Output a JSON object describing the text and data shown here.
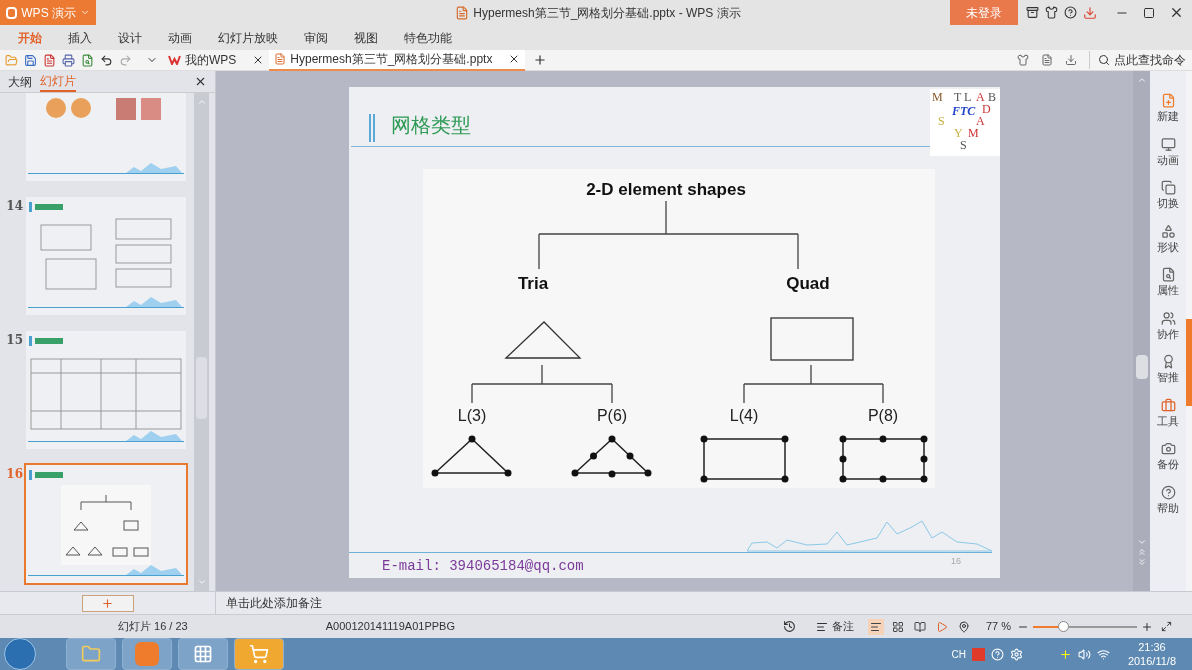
{
  "app_button": {
    "label": "WPS 演示"
  },
  "window": {
    "title": "Hypermesh第三节_网格划分基础.pptx - WPS 演示"
  },
  "login_button": {
    "label": "未登录"
  },
  "menu": [
    {
      "label": "开始",
      "selected": true
    },
    {
      "label": "插入",
      "selected": false
    },
    {
      "label": "设计",
      "selected": false
    },
    {
      "label": "动画",
      "selected": false
    },
    {
      "label": "幻灯片放映",
      "selected": false
    },
    {
      "label": "审阅",
      "selected": false
    },
    {
      "label": "视图",
      "selected": false
    },
    {
      "label": "特色功能",
      "selected": false
    }
  ],
  "doc_tabs": [
    {
      "label": "我的WPS",
      "kind": "home",
      "selected": false
    },
    {
      "label": "Hypermesh第三节_网格划分基础.pptx",
      "kind": "presentation",
      "selected": true
    }
  ],
  "search": {
    "placeholder": "点此查找命令"
  },
  "panel": {
    "tabs": [
      {
        "label": "大纲",
        "selected": false
      },
      {
        "label": "幻灯片",
        "selected": true
      }
    ],
    "thumbnails": [
      {
        "kind": "shapes",
        "selected": false
      },
      {
        "number": "14",
        "kind": "grids",
        "selected": false
      },
      {
        "number": "15",
        "kind": "table",
        "selected": false
      },
      {
        "number": "16",
        "kind": "tree",
        "selected": true
      }
    ]
  },
  "slide": {
    "title": "网格类型",
    "logo": [
      "M",
      "T",
      "L",
      "A",
      "B",
      "D",
      "FTC",
      "A",
      "S",
      "Y",
      "M",
      "S"
    ],
    "diagram": {
      "title": "2-D element shapes",
      "groups": [
        {
          "label": "Tria",
          "kind": "triangle",
          "children": [
            {
              "label": "L(3)",
              "kind": "linear"
            },
            {
              "label": "P(6)",
              "kind": "parabolic"
            }
          ]
        },
        {
          "label": "Quad",
          "kind": "quad",
          "children": [
            {
              "label": "L(4)",
              "kind": "linear"
            },
            {
              "label": "P(8)",
              "kind": "parabolic"
            }
          ]
        }
      ]
    },
    "email": "E-mail: 394065184@qq.com",
    "page_number": "16"
  },
  "sidebar": [
    {
      "label": "新建",
      "kind": "new"
    },
    {
      "label": "动画",
      "kind": "animation"
    },
    {
      "label": "切换",
      "kind": "transition"
    },
    {
      "label": "形状",
      "kind": "shape"
    },
    {
      "label": "属性",
      "kind": "properties"
    },
    {
      "label": "协作",
      "kind": "team"
    },
    {
      "label": "智推",
      "kind": "recommend"
    },
    {
      "label": "工具",
      "kind": "tools"
    },
    {
      "label": "备份",
      "kind": "backup"
    },
    {
      "label": "帮助",
      "kind": "help"
    }
  ],
  "notes": {
    "placeholder": "单击此处添加备注"
  },
  "status_bar": {
    "slide": "幻灯片 16 / 23",
    "template": "A000120141119A01PPBG",
    "notes_button": "备注",
    "views": [
      {
        "kind": "normal",
        "selected": true
      },
      {
        "kind": "sorter",
        "selected": false
      },
      {
        "kind": "reading",
        "selected": false
      },
      {
        "kind": "play",
        "selected": false
      }
    ],
    "zoom": "77 %",
    "zoom_slider": {
      "level": 0.29
    }
  },
  "taskbar": {
    "apps": [
      {
        "kind": "folder",
        "selected": false
      },
      {
        "kind": "wps",
        "selected": false
      },
      {
        "kind": "grid",
        "selected": false
      },
      {
        "kind": "cart",
        "selected": true
      }
    ],
    "language": "CH",
    "time": "21:36",
    "date": "2016/11/8"
  }
}
